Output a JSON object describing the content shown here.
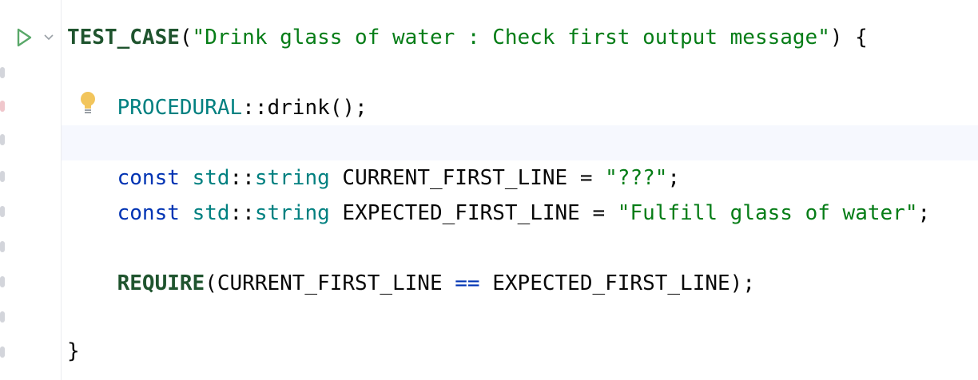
{
  "code": {
    "line1": {
      "macro": "TEST_CASE",
      "open": "(",
      "string": "\"Drink glass of water : Check first output message\"",
      "close": ") {"
    },
    "line2": {
      "indent": "    ",
      "ns": "PROCEDURAL",
      "sep": "::",
      "call": "drink();"
    },
    "line3": {
      "indent": "    ",
      "kw": "const",
      "sp1": " ",
      "ns": "std",
      "sep": "::",
      "type": "string",
      "rest": " CURRENT_FIRST_LINE = ",
      "string": "\"???\"",
      "end": ";"
    },
    "line4": {
      "indent": "    ",
      "kw": "const",
      "sp1": " ",
      "ns": "std",
      "sep": "::",
      "type": "string",
      "rest": " EXPECTED_FIRST_LINE = ",
      "string": "\"Fulfill glass of water\"",
      "end": ";"
    },
    "line5": {
      "indent": "    ",
      "macro": "REQUIRE",
      "open": "(CURRENT_FIRST_LINE ",
      "op": "==",
      "rest": " EXPECTED_FIRST_LINE);"
    },
    "line6": {
      "text": "}"
    }
  },
  "colors": {
    "keyword": "#0033b3",
    "namespace": "#008080",
    "string": "#067d17",
    "macro": "#1f542e",
    "run_icon": "#59a869",
    "bulb": "#f2c55c"
  },
  "icons": {
    "run": "run-gutter-icon",
    "fold": "chevron-down-icon",
    "intention": "lightbulb-icon"
  }
}
